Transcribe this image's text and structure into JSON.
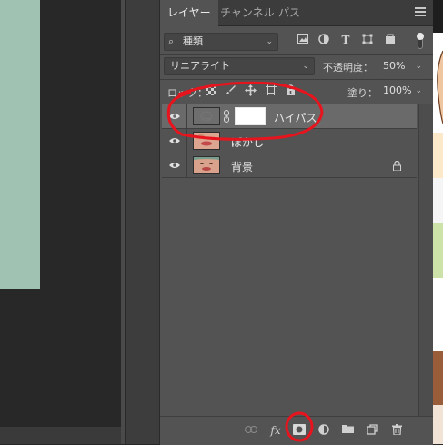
{
  "tabs": [
    "レイヤー",
    "チャンネル",
    "パス"
  ],
  "filter": {
    "icon": "search-icon",
    "value": "種類"
  },
  "blend_mode": "リニアライト",
  "opacity": {
    "label": "不透明度：",
    "value": "50%"
  },
  "lock": {
    "label": "ロック："
  },
  "fill": {
    "label": "塗り：",
    "value": "100%"
  },
  "layers": [
    {
      "name": "ハイパス",
      "selected": true
    },
    {
      "name": "ぼかし",
      "selected": false
    },
    {
      "name": "背景",
      "selected": false,
      "locked": true
    }
  ],
  "bottom_icons": [
    "link-icon",
    "fx-icon",
    "add-mask-icon",
    "adjustment-icon",
    "folder-icon",
    "new-layer-icon",
    "trash-icon"
  ],
  "colors": {
    "panel": "#535353",
    "tabbar": "#3c3c3c",
    "annotation": "#e8141d",
    "canvas_image": "#9fc2b3"
  }
}
